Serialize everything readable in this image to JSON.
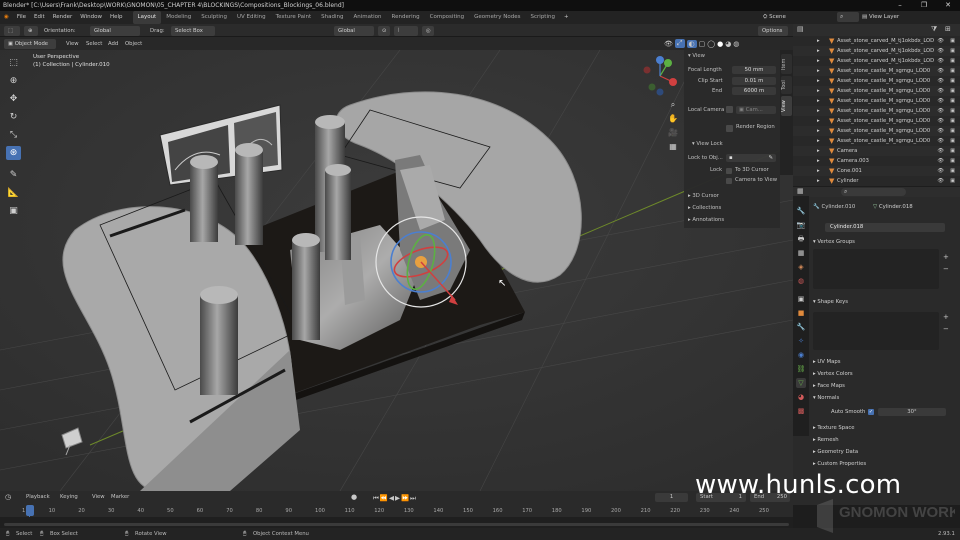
{
  "window": {
    "title": "Blender* [C:\\Users\\Frank\\Desktop\\WORK\\GNOMON\\05_CHAPTER 4\\BLOCKINGS\\Compositions_Blockings_06.blend]"
  },
  "menu": [
    "File",
    "Edit",
    "Render",
    "Window",
    "Help"
  ],
  "workspaces": [
    "Layout",
    "Modeling",
    "Sculpting",
    "UV Editing",
    "Texture Paint",
    "Shading",
    "Animation",
    "Rendering",
    "Compositing",
    "Geometry Nodes",
    "Scripting"
  ],
  "top_right": {
    "scene": "Scene",
    "view_layer": "View Layer"
  },
  "header": {
    "orientation_label": "Orientation:",
    "orientation_value": "Global",
    "drag_label": "Drag:",
    "drag_value": "Select Box",
    "transform": "Global",
    "options": "Options"
  },
  "header2": {
    "mode": "Object Mode",
    "view": "View",
    "select": "Select",
    "add": "Add",
    "object": "Object"
  },
  "viewport": {
    "line1": "User Perspective",
    "line2": "(1) Collection | Cylinder.010"
  },
  "npanel": {
    "view_header": "View",
    "focal_label": "Focal Length",
    "focal_value": "50 mm",
    "clip_start_label": "Clip Start",
    "clip_start_value": "0.01 m",
    "end_label": "End",
    "end_value": "6000 m",
    "local_camera": "Local Camera",
    "camera_field": "Cam...",
    "render_region": "Render Region",
    "view_lock_header": "View Lock",
    "lock_obj": "Lock to Obj...",
    "lock": "Lock",
    "to_3d_cursor": "To 3D Cursor",
    "camera_to_view": "Camera to View",
    "cursor_3d": "3D Cursor",
    "collections": "Collections",
    "annotations": "Annotations",
    "tabs": [
      "Item",
      "Tool",
      "View"
    ]
  },
  "outliner": {
    "rows": [
      "Asset_stone_carved_M_tj1okbdx_LOD",
      "Asset_stone_carved_M_tj1okbdx_LOD",
      "Asset_stone_carved_M_tj1okbdx_LOD",
      "Asset_stone_castle_M_sgmgu_LOD0",
      "Asset_stone_castle_M_sgmgu_LOD0",
      "Asset_stone_castle_M_sgmgu_LOD0",
      "Asset_stone_castle_M_sgmgu_LOD0",
      "Asset_stone_castle_M_sgmgu_LOD0",
      "Asset_stone_castle_M_sgmgu_LOD0",
      "Asset_stone_castle_M_sgmgu_LOD0",
      "Asset_stone_castle_M_sgmgu_LOD0",
      "Camera",
      "Camera.003",
      "Cone.001",
      "Cylinder"
    ]
  },
  "properties": {
    "object": "Cylinder.010",
    "mesh": "Cylinder.018",
    "mesh_field": "Cylinder.018",
    "sections": [
      "Vertex Groups",
      "Shape Keys",
      "UV Maps",
      "Vertex Colors",
      "Face Maps",
      "Normals"
    ],
    "auto_smooth": "Auto Smooth",
    "auto_smooth_value": "30°",
    "sections2": [
      "Texture Space",
      "Remesh",
      "Geometry Data",
      "Custom Properties"
    ]
  },
  "timeline": {
    "playback": "Playback",
    "keying": "Keying",
    "view": "View",
    "marker": "Marker",
    "frame": "1",
    "start_label": "Start",
    "start": "1",
    "end_label": "End",
    "end": "250",
    "ticks": [
      "1",
      "10",
      "20",
      "30",
      "40",
      "50",
      "60",
      "70",
      "80",
      "90",
      "100",
      "110",
      "120",
      "130",
      "140",
      "150",
      "160",
      "170",
      "180",
      "190",
      "200",
      "210",
      "220",
      "230",
      "240",
      "250"
    ]
  },
  "status": {
    "select": "Select",
    "box_select": "Box Select",
    "rotate_view": "Rotate View",
    "context_menu": "Object Context Menu",
    "version": "2.93.1"
  },
  "watermark": "www.hunls.com",
  "logo_text": "GNOMON WORKSHOP"
}
